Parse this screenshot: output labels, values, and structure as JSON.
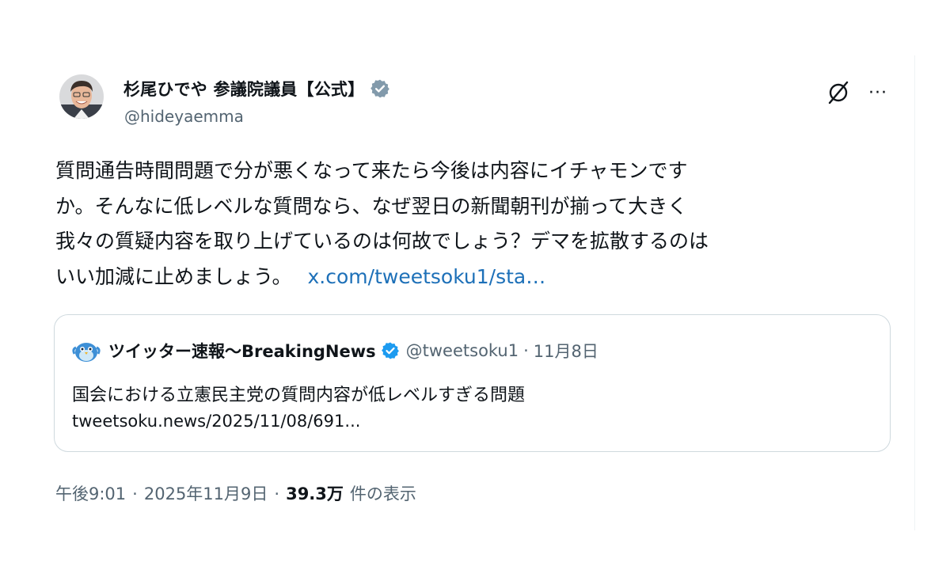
{
  "author": {
    "display_name": "杉尾ひでや 参議院議員【公式】",
    "handle": "@hideyaemma",
    "verified_color": "#829aab"
  },
  "actions": {
    "grok_icon": "grok-slash-icon",
    "more_icon": "ellipsis-icon",
    "more_label": "···"
  },
  "post": {
    "lines": [
      "質問通告時間問題で分が悪くなって来たら今後は内容にイチャモンです",
      "か。そんなに低レベルな質問なら、なぜ翌日の新聞朝刊が揃って大きく",
      "我々の質疑内容を取り上げているのは何故でしょう？デマを拡散するのは",
      "いい加減に止めましょう。"
    ],
    "link_text": "x.com/tweetsoku1/sta…",
    "link_color": "#1d70b8"
  },
  "quoted": {
    "display_name": "ツイッター速報〜BreakingNews",
    "handle": "@tweetsoku1",
    "separator": "·",
    "date": "11月8日",
    "title": "国会における立憲民主党の質問内容が低レベルすぎる問題",
    "url": "tweetsoku.news/2025/11/08/691...",
    "verified_color": "#1d9bf0"
  },
  "meta": {
    "time": "午後9:01",
    "sep1": "·",
    "date": "2025年11月9日",
    "sep2": "·",
    "views_count": "39.3万",
    "views_label": "件の表示"
  }
}
